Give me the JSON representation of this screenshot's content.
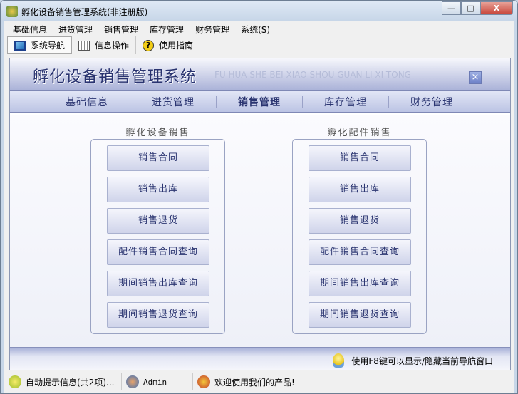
{
  "window": {
    "title": "孵化设备销售管理系统(非注册版)",
    "min": "—",
    "max": "□",
    "close": "X"
  },
  "menu": [
    "基础信息",
    "进货管理",
    "销售管理",
    "库存管理",
    "财务管理",
    "系统(S)"
  ],
  "toolbar": [
    {
      "label": "系统导航",
      "icon": "monitor-icon"
    },
    {
      "label": "信息操作",
      "icon": "grid-icon"
    },
    {
      "label": "使用指南",
      "icon": "help-icon"
    }
  ],
  "header": {
    "title": "孵化设备销售管理系统",
    "pinyin": "FU HUA SHE BEI XIAO SHOU GUAN LI XI TONG",
    "close": "×"
  },
  "tabs": [
    {
      "label": "基础信息"
    },
    {
      "label": "进货管理"
    },
    {
      "label": "销售管理",
      "active": true
    },
    {
      "label": "库存管理"
    },
    {
      "label": "财务管理"
    }
  ],
  "groups": [
    {
      "title": "孵化设备销售",
      "buttons": [
        "销售合同",
        "销售出库",
        "销售退货",
        "配件销售合同查询",
        "期间销售出库查询",
        "期间销售退货查询"
      ]
    },
    {
      "title": "孵化配件销售",
      "buttons": [
        "销售合同",
        "销售出库",
        "销售退货",
        "配件销售合同查询",
        "期间销售出库查询",
        "期间销售退货查询"
      ]
    }
  ],
  "footer": {
    "tip": "使用F8键可以显示/隐藏当前导航窗口"
  },
  "status": {
    "info": "自动提示信息(共2项)...",
    "user": "Admin",
    "welcome": "欢迎使用我们的产品!"
  }
}
